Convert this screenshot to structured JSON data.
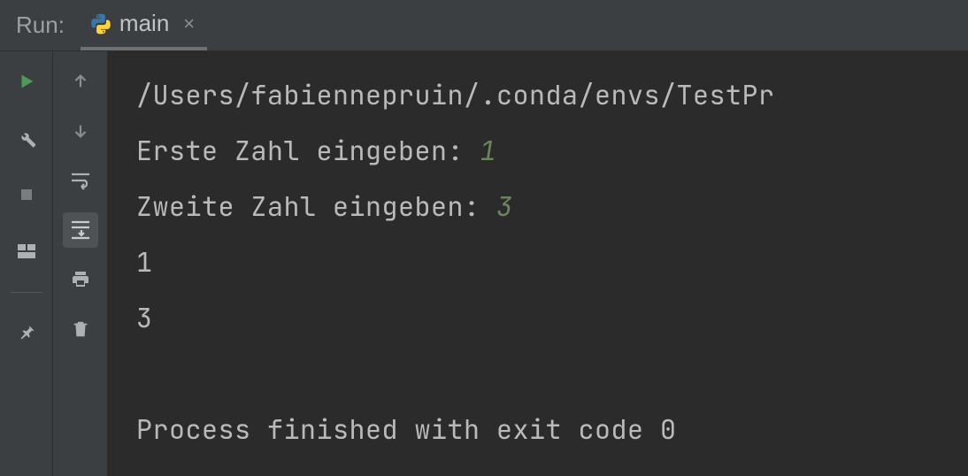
{
  "header": {
    "run_label": "Run:",
    "tab_label": "main"
  },
  "console": {
    "path_line": "/Users/fabiennepruin/.conda/envs/TestPr",
    "prompt1": "Erste Zahl eingeben: ",
    "input1": "1",
    "prompt2": "Zweite Zahl eingeben: ",
    "input2": "3",
    "output1": "1",
    "output2": "3",
    "exit_line": "Process finished with exit code 0"
  },
  "colors": {
    "input_green": "#6a8759",
    "run_green": "#499c54"
  }
}
